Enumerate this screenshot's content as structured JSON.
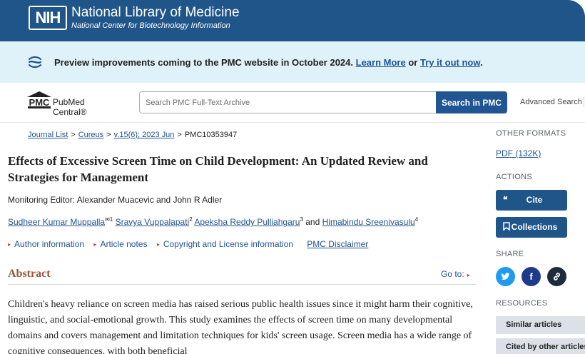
{
  "header": {
    "logo_text": "NIH",
    "title": "National Library of Medicine",
    "subtitle": "National Center for Biotechnology Information"
  },
  "banner": {
    "icon": "swirl-icon",
    "text_prefix": "Preview improvements coming to the PMC website in October 2024.",
    "learn_more": "Learn More",
    "or_text": "or",
    "try_it": "Try it out now",
    "period": "."
  },
  "search": {
    "logo_short": "PMC",
    "logo_name": "PubMed Central®",
    "placeholder": "Search PMC Full-Text Archive",
    "button_label": "Search in PMC",
    "advanced_label": "Advanced Search"
  },
  "breadcrumb": [
    {
      "label": "Journal List",
      "link": true
    },
    {
      "label": "Cureus",
      "link": true
    },
    {
      "label": "v.15(6); 2023 Jun",
      "link": true
    },
    {
      "label": "PMC10353947",
      "link": false
    }
  ],
  "article": {
    "title": "Effects of Excessive Screen Time on Child Development: An Updated Review and Strategies for Management",
    "monitoring_editor": "Monitoring Editor: Alexander Muacevic and John R Adler",
    "authors": [
      {
        "name": "Sudheer Kumar Muppalla",
        "sup": "✉1"
      },
      {
        "name": "Sravya Vuppalapati",
        "sup": "2"
      },
      {
        "name": "Apeksha Reddy Pulliahgaru",
        "sup": "3"
      },
      {
        "name": "Himabindu Sreenivasulu",
        "sup": "4"
      }
    ],
    "and_text": "and",
    "meta_links": [
      "Author information",
      "Article notes",
      "Copyright and License information"
    ],
    "disclaimer": "PMC Disclaimer",
    "abstract_heading": "Abstract",
    "goto_label": "Go to:",
    "abstract_text": "Children's heavy reliance on screen media has raised serious public health issues since it might harm their cognitive, linguistic, and social-emotional growth. This study examines the effects of screen time on many developmental domains and covers management and limitation techniques for kids' screen usage. Screen media has a wide range of cognitive consequences, with both beneficial"
  },
  "sidebar": {
    "other_formats_label": "OTHER FORMATS",
    "pdf_label": "PDF (132K)",
    "actions_label": "ACTIONS",
    "cite_label": "Cite",
    "collections_label": "Collections",
    "share_label": "SHARE",
    "share": [
      {
        "icon": "twitter-icon",
        "glyph": "t",
        "color": "#1d9bf0"
      },
      {
        "icon": "facebook-icon",
        "glyph": "f",
        "color": "#1f3a8a"
      },
      {
        "icon": "link-icon",
        "glyph": "⚭",
        "color": "#1e2b3c"
      }
    ],
    "resources_label": "RESOURCES",
    "resources": [
      "Similar articles",
      "Cited by other articles"
    ]
  },
  "colors": {
    "header_blue": "#20558a",
    "banner_bg": "#dff2fa",
    "link_blue": "#205493",
    "abstract_heading": "#985735"
  }
}
